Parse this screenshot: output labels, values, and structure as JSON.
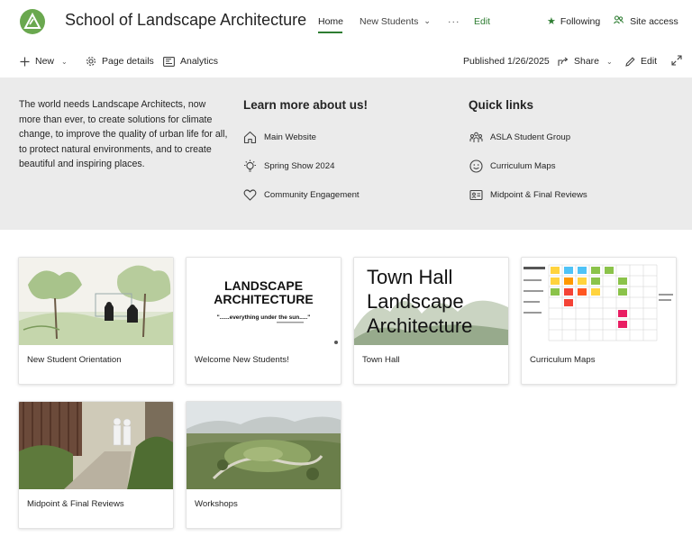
{
  "header": {
    "site_title": "School of Landscape Architecture",
    "nav": {
      "home": "Home",
      "new_students": "New Students",
      "more": "···",
      "edit": "Edit"
    },
    "following": "Following",
    "site_access": "Site access"
  },
  "command_bar": {
    "new": "New",
    "page_details": "Page details",
    "analytics": "Analytics",
    "published": "Published 1/26/2025",
    "share": "Share",
    "edit": "Edit"
  },
  "hero": {
    "intro": "The world needs Landscape Architects, now more than ever, to create solutions for climate change, to improve the quality of urban life for all, to protect natural environments, and to create beautiful and inspiring places.",
    "learn_more": {
      "heading": "Learn more about us!",
      "links": [
        {
          "label": "Main Website",
          "icon": "home-icon"
        },
        {
          "label": "Spring Show 2024",
          "icon": "lightbulb-icon"
        },
        {
          "label": "Community Engagement",
          "icon": "heart-icon"
        }
      ]
    },
    "quick_links": {
      "heading": "Quick links",
      "links": [
        {
          "label": "ASLA Student Group",
          "icon": "people-community-icon"
        },
        {
          "label": "Curriculum Maps",
          "icon": "smile-icon"
        },
        {
          "label": "Midpoint & Final Reviews",
          "icon": "contact-card-icon"
        }
      ]
    }
  },
  "cards": [
    {
      "caption": "New Student Orientation",
      "image": "sketch of people seated outdoors"
    },
    {
      "caption": "Welcome New Students!",
      "image": "title slide",
      "slide": {
        "line1": "LANDSCAPE",
        "line2": "ARCHITECTURE",
        "tagline": "\"......everything under the sun.....\""
      }
    },
    {
      "caption": "Town Hall",
      "image": "title slide with trees",
      "slide": {
        "line1": "Town Hall",
        "line2": "Landscape",
        "line3": "Architecture"
      }
    },
    {
      "caption": "Curriculum Maps",
      "image": "curriculum grid chart"
    },
    {
      "caption": "Midpoint & Final Reviews",
      "image": "garden rendering with figures"
    },
    {
      "caption": "Workshops",
      "image": "aerial landscape rendering"
    }
  ],
  "colors": {
    "accent": "#2e7d32",
    "logo": "#6aa84f",
    "band": "#ebebeb"
  }
}
